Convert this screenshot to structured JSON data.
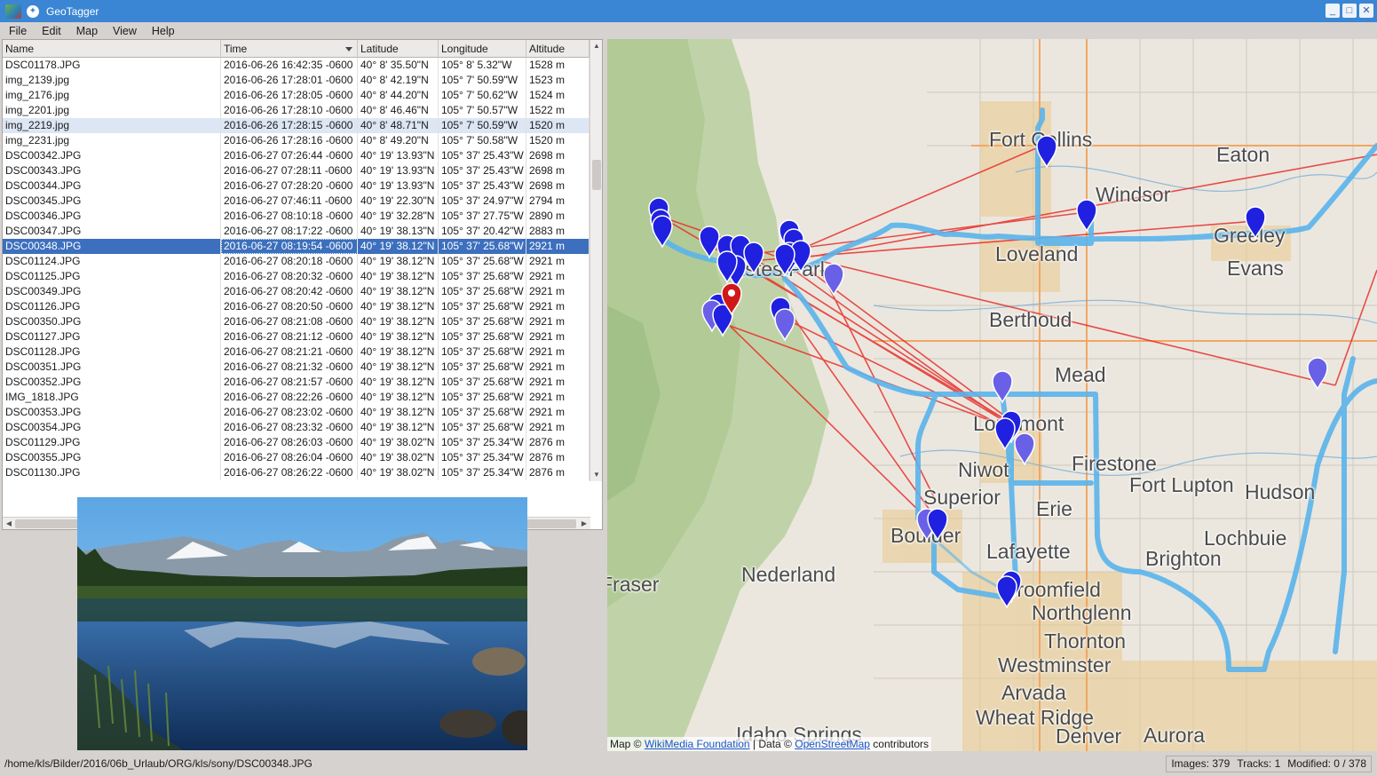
{
  "window": {
    "title": "GeoTagger",
    "buttons": [
      "_",
      "□",
      "✕"
    ]
  },
  "menu": [
    "File",
    "Edit",
    "Map",
    "View",
    "Help"
  ],
  "table": {
    "columns": [
      "Name",
      "Time",
      "Latitude",
      "Longitude",
      "Altitude"
    ],
    "sorted_column": "Time",
    "selected_index": 12,
    "hover_index": 4,
    "rows": [
      [
        "DSC01178.JPG",
        "2016-06-26 16:42:35 -0600",
        "40° 8' 35.50\"N",
        "105° 8'  5.32\"W",
        "1528 m"
      ],
      [
        "img_2139.jpg",
        "2016-06-26 17:28:01 -0600",
        "40° 8' 42.19\"N",
        "105° 7' 50.59\"W",
        "1523 m"
      ],
      [
        "img_2176.jpg",
        "2016-06-26 17:28:05 -0600",
        "40° 8' 44.20\"N",
        "105° 7' 50.62\"W",
        "1524 m"
      ],
      [
        "img_2201.jpg",
        "2016-06-26 17:28:10 -0600",
        "40° 8' 46.46\"N",
        "105° 7' 50.57\"W",
        "1522 m"
      ],
      [
        "img_2219.jpg",
        "2016-06-26 17:28:15 -0600",
        "40° 8' 48.71\"N",
        "105° 7' 50.59\"W",
        "1520 m"
      ],
      [
        "img_2231.jpg",
        "2016-06-26 17:28:16 -0600",
        "40° 8' 49.20\"N",
        "105° 7' 50.58\"W",
        "1520 m"
      ],
      [
        "DSC00342.JPG",
        "2016-06-27 07:26:44 -0600",
        "40° 19' 13.93\"N",
        "105° 37' 25.43\"W",
        "2698 m"
      ],
      [
        "DSC00343.JPG",
        "2016-06-27 07:28:11 -0600",
        "40° 19' 13.93\"N",
        "105° 37' 25.43\"W",
        "2698 m"
      ],
      [
        "DSC00344.JPG",
        "2016-06-27 07:28:20 -0600",
        "40° 19' 13.93\"N",
        "105° 37' 25.43\"W",
        "2698 m"
      ],
      [
        "DSC00345.JPG",
        "2016-06-27 07:46:11 -0600",
        "40° 19' 22.30\"N",
        "105° 37' 24.97\"W",
        "2794 m"
      ],
      [
        "DSC00346.JPG",
        "2016-06-27 08:10:18 -0600",
        "40° 19' 32.28\"N",
        "105° 37' 27.75\"W",
        "2890 m"
      ],
      [
        "DSC00347.JPG",
        "2016-06-27 08:17:22 -0600",
        "40° 19' 38.13\"N",
        "105° 37' 20.42\"W",
        "2883 m"
      ],
      [
        "DSC00348.JPG",
        "2016-06-27 08:19:54 -0600",
        "40° 19' 38.12\"N",
        "105° 37' 25.68\"W",
        "2921 m"
      ],
      [
        "DSC01124.JPG",
        "2016-06-27 08:20:18 -0600",
        "40° 19' 38.12\"N",
        "105° 37' 25.68\"W",
        "2921 m"
      ],
      [
        "DSC01125.JPG",
        "2016-06-27 08:20:32 -0600",
        "40° 19' 38.12\"N",
        "105° 37' 25.68\"W",
        "2921 m"
      ],
      [
        "DSC00349.JPG",
        "2016-06-27 08:20:42 -0600",
        "40° 19' 38.12\"N",
        "105° 37' 25.68\"W",
        "2921 m"
      ],
      [
        "DSC01126.JPG",
        "2016-06-27 08:20:50 -0600",
        "40° 19' 38.12\"N",
        "105° 37' 25.68\"W",
        "2921 m"
      ],
      [
        "DSC00350.JPG",
        "2016-06-27 08:21:08 -0600",
        "40° 19' 38.12\"N",
        "105° 37' 25.68\"W",
        "2921 m"
      ],
      [
        "DSC01127.JPG",
        "2016-06-27 08:21:12 -0600",
        "40° 19' 38.12\"N",
        "105° 37' 25.68\"W",
        "2921 m"
      ],
      [
        "DSC01128.JPG",
        "2016-06-27 08:21:21 -0600",
        "40° 19' 38.12\"N",
        "105° 37' 25.68\"W",
        "2921 m"
      ],
      [
        "DSC00351.JPG",
        "2016-06-27 08:21:32 -0600",
        "40° 19' 38.12\"N",
        "105° 37' 25.68\"W",
        "2921 m"
      ],
      [
        "DSC00352.JPG",
        "2016-06-27 08:21:57 -0600",
        "40° 19' 38.12\"N",
        "105° 37' 25.68\"W",
        "2921 m"
      ],
      [
        "IMG_1818.JPG",
        "2016-06-27 08:22:26 -0600",
        "40° 19' 38.12\"N",
        "105° 37' 25.68\"W",
        "2921 m"
      ],
      [
        "DSC00353.JPG",
        "2016-06-27 08:23:02 -0600",
        "40° 19' 38.12\"N",
        "105° 37' 25.68\"W",
        "2921 m"
      ],
      [
        "DSC00354.JPG",
        "2016-06-27 08:23:32 -0600",
        "40° 19' 38.12\"N",
        "105° 37' 25.68\"W",
        "2921 m"
      ],
      [
        "DSC01129.JPG",
        "2016-06-27 08:26:03 -0600",
        "40° 19' 38.02\"N",
        "105° 37' 25.34\"W",
        "2876 m"
      ],
      [
        "DSC00355.JPG",
        "2016-06-27 08:26:04 -0600",
        "40° 19' 38.02\"N",
        "105° 37' 25.34\"W",
        "2876 m"
      ],
      [
        "DSC01130.JPG",
        "2016-06-27 08:26:22 -0600",
        "40° 19' 38.02\"N",
        "105° 37' 25.34\"W",
        "2876 m"
      ]
    ]
  },
  "map": {
    "place_labels": [
      "Fort Collins",
      "Eaton",
      "Windsor",
      "Greeley",
      "Loveland",
      "Evans",
      "Berthoud",
      "Mead",
      "Longmont",
      "Firestone",
      "Niwot",
      "Fort Lupton",
      "Hudson",
      "Superior",
      "Erie",
      "Boulder",
      "Brighton",
      "Lafayette",
      "Lochbuie",
      "Nederland",
      "Fraser",
      "Broomfield",
      "Northglenn",
      "Thornton",
      "Westminster",
      "Arvada",
      "Wheat Ridge",
      "Idaho Springs",
      "Denver",
      "Aurora",
      "Estes Park"
    ],
    "attribution": {
      "prefix": "Map © ",
      "tiles_link": "WikiMedia Foundation",
      "middle": " | Data © ",
      "data_link": "OpenStreetMap",
      "suffix": " contributors"
    },
    "colors": {
      "track": "#5ab4ec",
      "link_lines": "#e8302c",
      "marker": "#2020e0",
      "marker_faded": "#6a60e8",
      "selected_marker": "#d01818"
    }
  },
  "status": {
    "path": "/home/kls/Bilder/2016/06b_Urlaub/ORG/kls/sony/DSC00348.JPG",
    "images": "Images: 379",
    "tracks": "Tracks: 1",
    "modified": "Modified: 0 / 378"
  }
}
